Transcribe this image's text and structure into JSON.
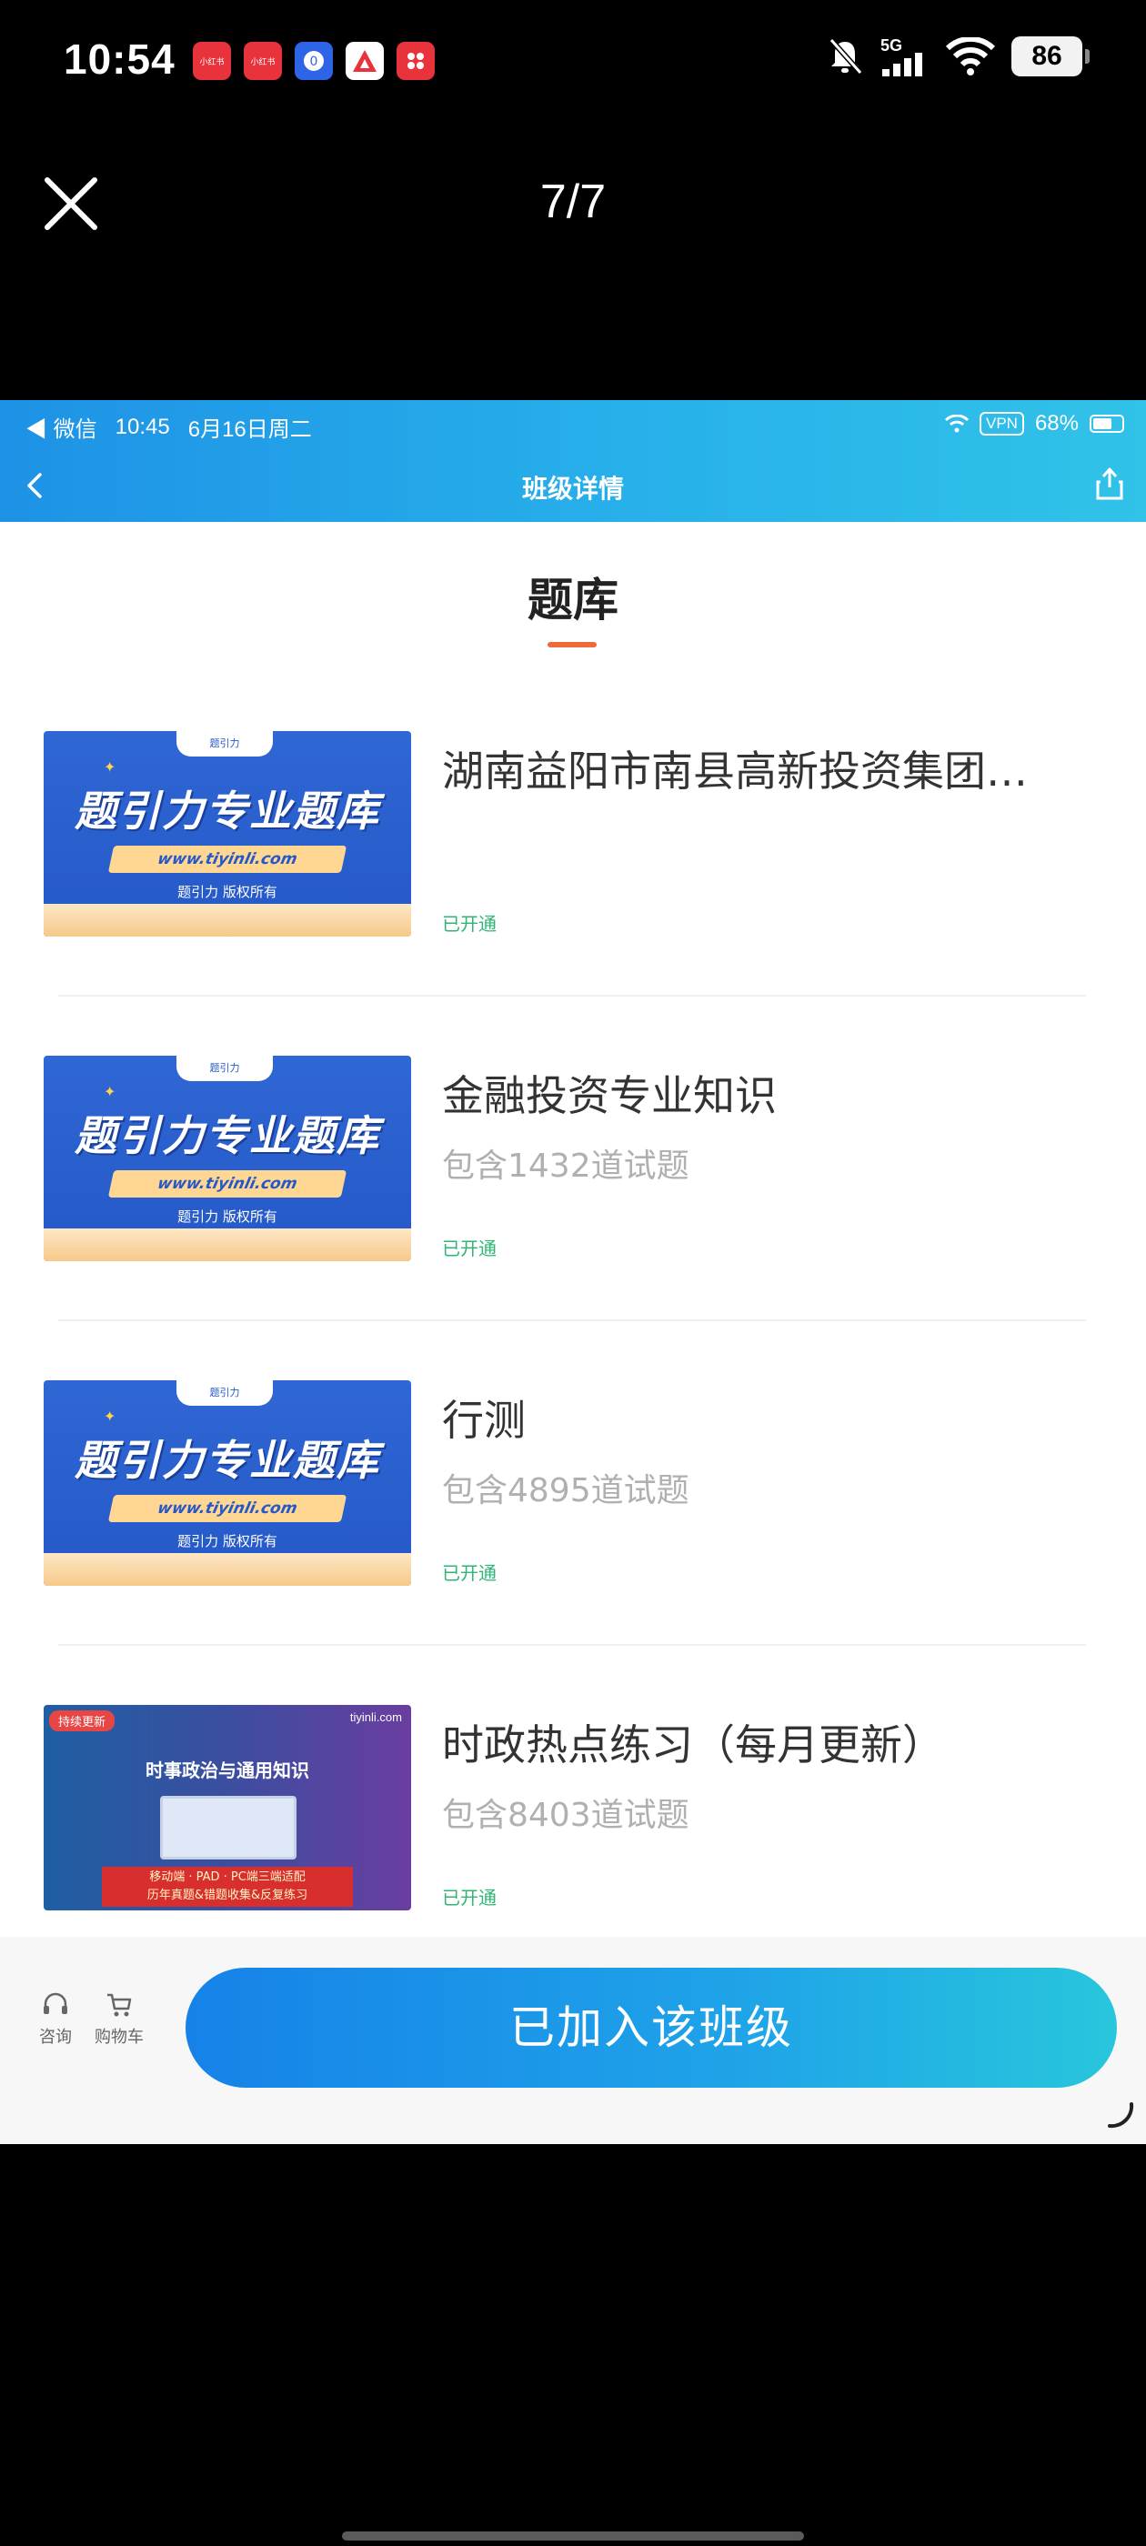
{
  "status_bar": {
    "time": "10:54",
    "apps": [
      {
        "label": "小红书",
        "color": "#e8323c"
      },
      {
        "label": "小红书",
        "color": "#e8323c"
      },
      {
        "label": "",
        "color": "#2e64e6"
      },
      {
        "label": "",
        "color": "#ffffff"
      },
      {
        "label": "",
        "color": "#e8323c"
      }
    ],
    "network": "5G",
    "battery": "86"
  },
  "viewer": {
    "counter": "7/7"
  },
  "inner_status": {
    "app": "◀ 微信",
    "time": "10:45",
    "date": "6月16日周二",
    "vpn": "VPN",
    "battery": "68%"
  },
  "header": {
    "title": "班级详情"
  },
  "section": {
    "title": "题库"
  },
  "thumb_blue": {
    "tab": "题引力",
    "headline": "题引力专业题库",
    "url": "www.tiyinli.com",
    "copyright": "题引力 版权所有"
  },
  "thumb_purple": {
    "badge": "持续更新",
    "site": "tiyinli.com",
    "headline": "时事政治与通用知识",
    "line1": "移动端 · PAD · PC端三端适配",
    "line2": "历年真题&错题收集&反复练习"
  },
  "items": [
    {
      "title": "湖南益阳市南县高新投资集团…",
      "subtitle": "",
      "status": "已开通"
    },
    {
      "title": "金融投资专业知识",
      "subtitle": "包含1432道试题",
      "status": "已开通"
    },
    {
      "title": "行测",
      "subtitle": "包含4895道试题",
      "status": "已开通"
    },
    {
      "title": "时政热点练习（每月更新）",
      "subtitle": "包含8403道试题",
      "status": "已开通"
    }
  ],
  "bottom": {
    "consult": "咨询",
    "cart": "购物车",
    "join_label": "已加入该班级"
  },
  "colors": {
    "accent_orange": "#ef6a3a",
    "status_green": "#2fb574",
    "header_blue": "#1e92e6"
  }
}
